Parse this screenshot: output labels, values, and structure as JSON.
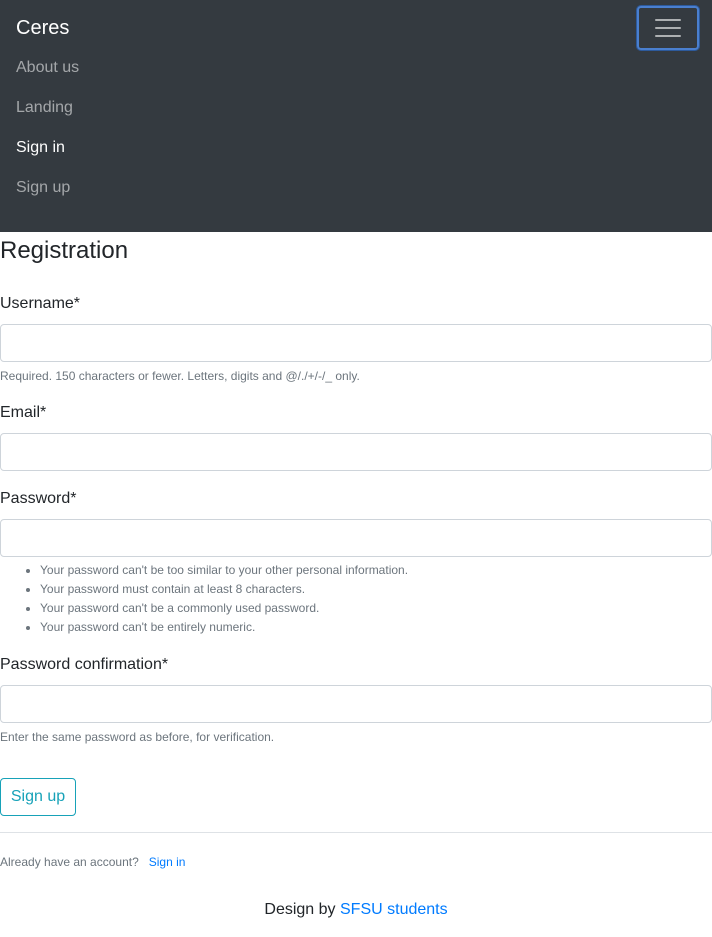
{
  "navbar": {
    "brand": "Ceres",
    "toggler_icon": "hamburger-menu-icon",
    "items": [
      {
        "label": "About us"
      },
      {
        "label": "Landing"
      },
      {
        "label": "Sign in"
      },
      {
        "label": "Sign up"
      }
    ],
    "active_item": "Sign in"
  },
  "form": {
    "title": "Registration",
    "username": {
      "label": "Username*",
      "value": "",
      "help": "Required. 150 characters or fewer. Letters, digits and @/./+/-/_ only."
    },
    "email": {
      "label": "Email*",
      "value": ""
    },
    "password": {
      "label": "Password*",
      "value": "",
      "rules": [
        "Your password can't be too similar to your other personal information.",
        "Your password must contain at least 8 characters.",
        "Your password can't be a commonly used password.",
        "Your password can't be entirely numeric."
      ]
    },
    "password_confirmation": {
      "label": "Password confirmation*",
      "value": "",
      "help": "Enter the same password as before, for verification."
    },
    "submit_label": "Sign up"
  },
  "account": {
    "prompt": "Already have an account?",
    "link_label": "Sign in"
  },
  "footer": {
    "prefix": "Design by",
    "link_label": "SFSU students"
  },
  "colors": {
    "navbar_bg": "#343a40",
    "accent_button": "#17a2b8",
    "link": "#007bff",
    "toggler_focus": "#4a7fcf"
  }
}
